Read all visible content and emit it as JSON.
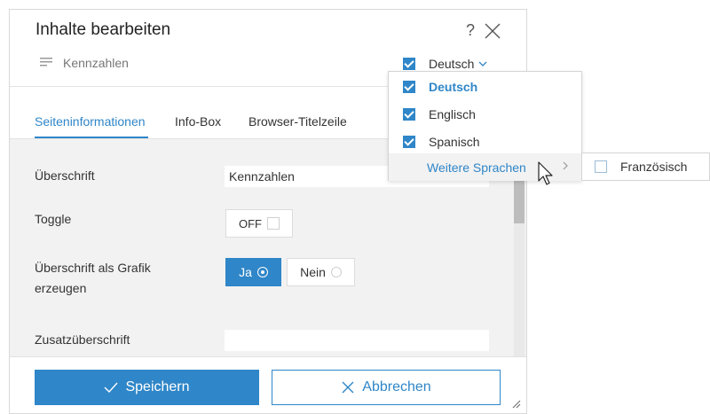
{
  "dialog": {
    "title": "Inhalte bearbeiten",
    "help_glyph": "?",
    "content_type": "Kennzahlen",
    "language_selector": {
      "label": "Deutsch",
      "checked": true
    }
  },
  "tabs": [
    {
      "label": "Seiteninformationen",
      "active": true
    },
    {
      "label": "Info-Box",
      "active": false
    },
    {
      "label": "Browser-Titelzeile",
      "active": false
    }
  ],
  "form": {
    "ueberschrift": {
      "label": "Überschrift",
      "value": "Kennzahlen"
    },
    "toggle": {
      "label": "Toggle",
      "state": "OFF"
    },
    "grafik": {
      "label_line1": "Überschrift als Grafik",
      "label_line2": "erzeugen",
      "yes": "Ja",
      "no": "Nein",
      "selected": "Ja"
    },
    "zusatz": {
      "label": "Zusatzüberschrift",
      "value": ""
    }
  },
  "footer": {
    "save": "Speichern",
    "cancel": "Abbrechen"
  },
  "language_dropdown": {
    "items": [
      {
        "label": "Deutsch",
        "checked": true,
        "current": true
      },
      {
        "label": "Englisch",
        "checked": true
      },
      {
        "label": "Spanisch",
        "checked": true
      }
    ],
    "more_label": "Weitere Sprachen",
    "submenu_items": [
      {
        "label": "Französisch",
        "checked": false
      }
    ]
  },
  "colors": {
    "accent": "#2f86c8",
    "form_background": "#f2f2f2",
    "border": "#d9d9d9"
  }
}
